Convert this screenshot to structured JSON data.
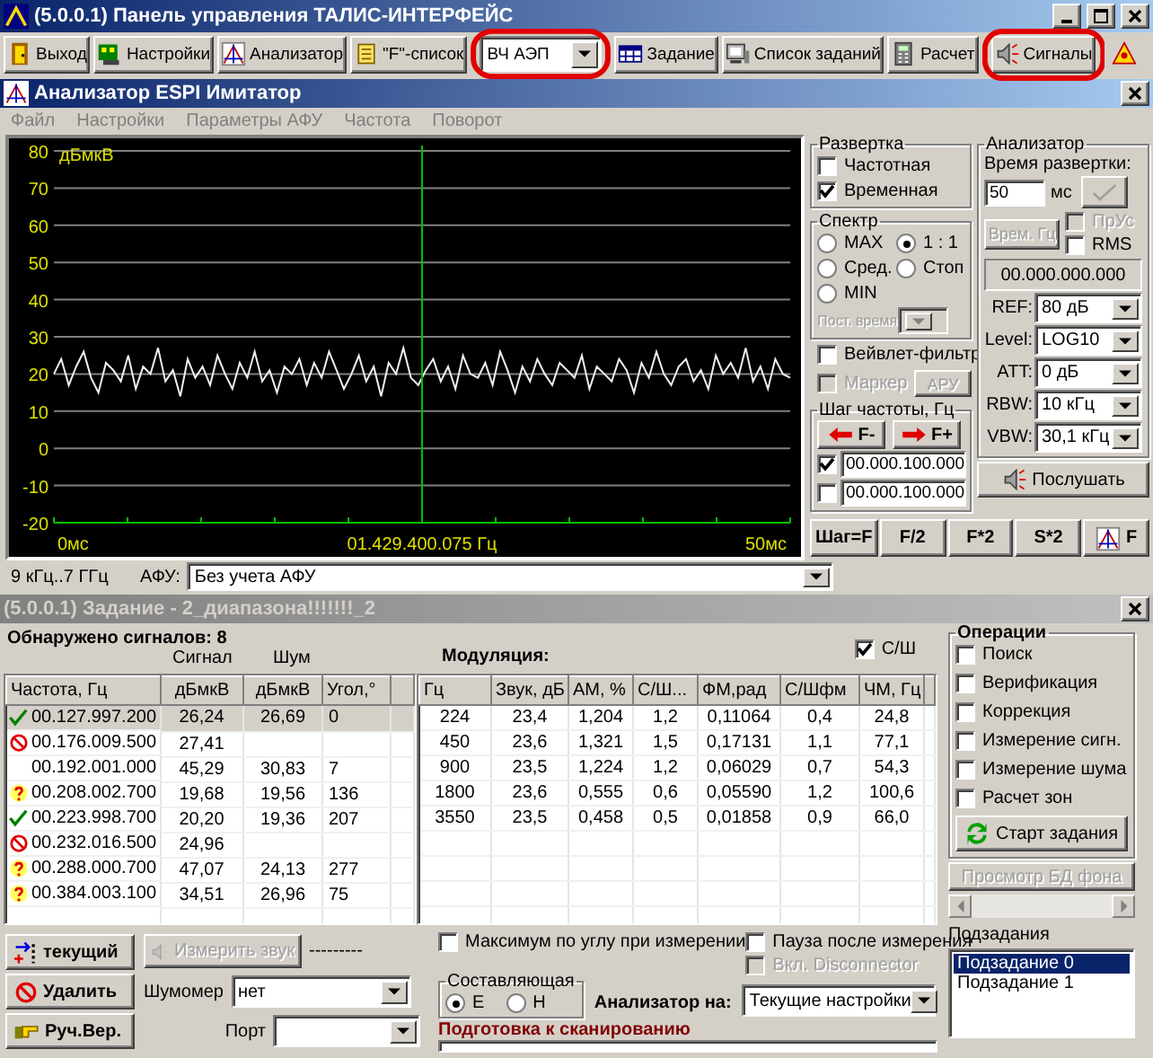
{
  "main_window": {
    "title": "(5.0.0.1) Панель управления ТАЛИС-ИНТЕРФЕЙС"
  },
  "toolbar": [
    {
      "kind": "button",
      "label": "Выход",
      "highlighted": false
    },
    {
      "kind": "button",
      "label": "Настройки",
      "highlighted": false
    },
    {
      "kind": "button",
      "label": "Анализатор",
      "highlighted": false
    },
    {
      "kind": "button",
      "label": "\"F\"-список",
      "highlighted": false
    },
    {
      "kind": "dropdown",
      "label": "ВЧ АЭП",
      "highlighted": true
    },
    {
      "kind": "button",
      "label": "Задание",
      "highlighted": false
    },
    {
      "kind": "button",
      "label": "Список заданий",
      "highlighted": false
    },
    {
      "kind": "button",
      "label": "Расчет",
      "highlighted": false
    },
    {
      "kind": "button",
      "label": "Сигналы",
      "highlighted": true
    },
    {
      "kind": "iconbutton",
      "highlighted": false
    }
  ],
  "analyzer": {
    "title": "Анализатор ESPI Имитатор",
    "menu": [
      "Файл",
      "Настройки",
      "Параметры АФУ",
      "Частота",
      "Поворот"
    ],
    "plot": {
      "marker_frequency": "01.429.400.075 Гц",
      "x_start": "0мс",
      "x_end": "50мс",
      "chart_data": {
        "type": "line",
        "ylabel": "дБмкВ",
        "ylim": [
          -20,
          80
        ],
        "grid": true,
        "yticks": [
          80,
          70,
          60,
          50,
          40,
          30,
          20,
          10,
          0,
          -10,
          -20
        ],
        "series": [
          {
            "color": "#f0f0f0",
            "values": [
              20,
              24,
              17,
              22,
              26,
              19,
              15,
              23,
              21,
              18,
              25,
              16,
              22,
              20,
              27,
              18,
              21,
              14,
              24,
              19,
              22,
              17,
              25,
              20,
              16,
              23,
              19,
              26,
              18,
              21,
              15,
              22,
              20,
              24,
              17,
              23,
              19,
              26,
              21,
              16,
              20,
              25,
              18,
              22,
              14,
              23,
              20,
              27,
              19,
              17,
              21,
              24,
              18,
              22,
              16,
              25,
              20,
              19,
              23,
              17,
              26,
              21,
              15,
              22,
              18,
              24,
              20,
              17,
              23,
              21,
              19,
              25,
              16,
              22,
              20,
              18,
              24,
              21,
              15,
              23,
              19,
              26,
              20,
              17,
              22,
              24,
              18,
              21,
              16,
              25,
              20,
              23,
              19,
              27,
              18,
              22,
              16,
              24,
              20,
              19
            ]
          }
        ]
      }
    },
    "range": "9 кГц..7 ГГц",
    "afu_label": "АФУ:",
    "afu_value": "Без учета АФУ",
    "sweep": {
      "title": "Развертка",
      "options": [
        {
          "label": "Частотная",
          "checked": false
        },
        {
          "label": "Временная",
          "checked": true
        }
      ]
    },
    "spectrum": {
      "title": "Спектр",
      "modes": [
        {
          "label": "MAX",
          "selected": false
        },
        {
          "label": "1 : 1",
          "selected": true
        },
        {
          "label": "Сред.",
          "selected": false
        },
        {
          "label": "Стоп",
          "selected": false
        },
        {
          "label": "MIN",
          "selected": false
        }
      ],
      "time_const_label": "Пост. время"
    },
    "wavelet": {
      "label": "Вейвлет-фильтр",
      "checked": false
    },
    "marker": {
      "label": "Маркер",
      "checked": false,
      "disabled": true
    },
    "agc_button": {
      "label": "АРУ",
      "disabled": true
    },
    "step": {
      "title": "Шаг частоты, Гц",
      "minus": "F-",
      "plus": "F+",
      "values": [
        {
          "value": "00.000.100.000",
          "checked": true
        },
        {
          "value": "00.000.100.000",
          "checked": false
        }
      ]
    },
    "panel": {
      "title": "Анализатор",
      "sweep_time_label": "Время развертки:",
      "sweep_time": "50",
      "unit": "мс",
      "time_button": {
        "label": "Врем. Гц",
        "disabled": true
      },
      "pr_us": {
        "label": "ПрУс",
        "checked": false,
        "disabled": true
      },
      "rms": {
        "label": "RMS",
        "checked": false,
        "disabled": false
      },
      "frequency": "00.000.000.000",
      "settings": [
        {
          "label": "REF:",
          "value": "80 дБ"
        },
        {
          "label": "Level:",
          "value": "LOG10"
        },
        {
          "label": "ATT:",
          "value": "0 дБ"
        },
        {
          "label": "RBW:",
          "value": "10 кГц"
        },
        {
          "label": "VBW:",
          "value": "30,1 кГц"
        }
      ],
      "listen_button": "Послушать"
    },
    "bottom_buttons": [
      "Шаг=F",
      "F/2",
      "F*2",
      "S*2",
      "F"
    ]
  },
  "task": {
    "title": "(5.0.0.1) Задание - 2_диапазона!!!!!!!_2",
    "found": "Обнаружено сигналов: 8",
    "signal_header": "Сигнал",
    "noise_header": "Шум",
    "columns": [
      "Частота, Гц",
      "дБмкВ",
      "дБмкВ",
      "Угол,°"
    ],
    "rows": [
      {
        "kind": "ok",
        "freq": "00.127.997.200",
        "signal": "26,24",
        "noise": "26,69",
        "angle": "0",
        "selected": true
      },
      {
        "kind": "rejected",
        "freq": "00.176.009.500",
        "signal": "27,41",
        "selected": false
      },
      {
        "kind": "plain",
        "freq": "00.192.001.000",
        "signal": "45,29",
        "noise": "30,83",
        "angle": "7",
        "selected": false
      },
      {
        "kind": "unknown",
        "freq": "00.208.002.700",
        "signal": "19,68",
        "noise": "19,56",
        "angle": "136",
        "selected": false
      },
      {
        "kind": "ok",
        "freq": "00.223.998.700",
        "signal": "20,20",
        "noise": "19,36",
        "angle": "207",
        "selected": false
      },
      {
        "kind": "rejected",
        "freq": "00.232.016.500",
        "signal": "24,96",
        "selected": false
      },
      {
        "kind": "unknown",
        "freq": "00.288.000.700",
        "signal": "47,07",
        "noise": "24,13",
        "angle": "277",
        "selected": false
      },
      {
        "kind": "unknown",
        "freq": "00.384.003.100",
        "signal": "34,51",
        "noise": "26,96",
        "angle": "75",
        "selected": false
      }
    ],
    "modulation_title": "Модуляция:",
    "snr_check": {
      "label": "С/Ш",
      "checked": true
    },
    "mod_columns": [
      "Гц",
      "Звук, дБ",
      "АМ, %",
      "С/Ш...",
      "ФМ,рад",
      "С/Шфм",
      "ЧМ, Гц"
    ],
    "mod_rows": [
      [
        "224",
        "23,4",
        "1,204",
        "1,2",
        "0,11064",
        "0,4",
        "24,8"
      ],
      [
        "450",
        "23,6",
        "1,321",
        "1,5",
        "0,17131",
        "1,1",
        "77,1"
      ],
      [
        "900",
        "23,5",
        "1,224",
        "1,2",
        "0,06029",
        "0,7",
        "54,3"
      ],
      [
        "1800",
        "23,6",
        "0,555",
        "0,6",
        "0,05590",
        "1,2",
        "100,6"
      ],
      [
        "3550",
        "23,5",
        "0,458",
        "0,5",
        "0,01858",
        "0,9",
        "66,0"
      ]
    ],
    "operations": {
      "title": "Операции",
      "items": [
        {
          "label": "Поиск",
          "checked": false
        },
        {
          "label": "Верификация",
          "checked": false
        },
        {
          "label": "Коррекция",
          "checked": false
        },
        {
          "label": "Измерение сигн.",
          "checked": false
        },
        {
          "label": "Измерение шума",
          "checked": false
        },
        {
          "label": "Расчет зон",
          "checked": false
        }
      ],
      "start_button": "Старт задания"
    },
    "background_db_button": {
      "label": "Просмотр БД фона",
      "disabled": true
    },
    "subtasks": {
      "title": "Подзадания",
      "items": [
        {
          "label": "Подзадание 0",
          "selected": true
        },
        {
          "label": "Подзадание 1",
          "selected": false
        }
      ]
    },
    "current_button": "текущий",
    "delete_button": "Удалить",
    "manual_button": "Руч.Вер.",
    "measure_button": {
      "label": "Измерить звук",
      "disabled": true
    },
    "dashes": "---------",
    "noise_meter_label": "Шумомер",
    "noise_meter_value": "нет",
    "port_label": "Порт",
    "max_angle": {
      "label": "Максимум по углу при измерении",
      "checked": false
    },
    "pause": {
      "label": "Пауза после измерения",
      "checked": false,
      "disabled": false
    },
    "disconnector": {
      "label": "Вкл. Disconnector",
      "checked": false,
      "disabled": true
    },
    "component": {
      "title": "Составляющая",
      "options": [
        {
          "label": "E",
          "selected": true
        },
        {
          "label": "H",
          "selected": false
        }
      ]
    },
    "analyzer_on_label": "Анализатор на:",
    "analyzer_on_value": "Текущие настройки",
    "status": "Подготовка к сканированию",
    "progress": {
      "level": 0
    }
  }
}
